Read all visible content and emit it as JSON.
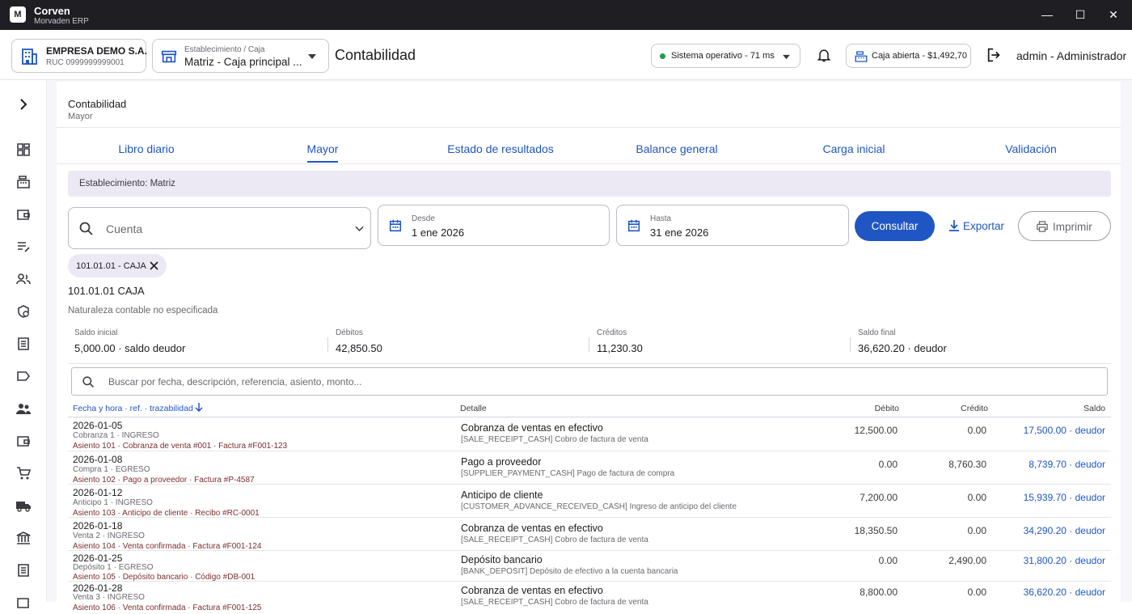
{
  "titlebar": {
    "logo": "M",
    "app": "Corven",
    "subtitle": "Morvaden ERP"
  },
  "header": {
    "company_name": "EMPRESA DEMO S.A.",
    "company_ruc": "RUC 0999999999001",
    "establishment_label": "Establecimiento / Caja",
    "establishment_value": "Matriz - Caja principal ...",
    "page_title": "Contabilidad",
    "status_text": "Sistema operativo - 71 ms",
    "cash_text": "Caja abierta - $1,492,70",
    "user_text": "admin - Administrador",
    "status_color": "#1f9d4a"
  },
  "sidebar": {
    "icons": [
      "chevron-right-icon",
      "dashboard-icon",
      "cash-register-icon",
      "wallet-icon",
      "edit-list-icon",
      "users-icon",
      "clock-badge-icon",
      "list-icon",
      "label-icon",
      "people-icon",
      "wallet-2-icon",
      "cart-icon",
      "truck-icon",
      "bank-icon",
      "document-icon",
      "more-icon"
    ]
  },
  "page": {
    "title": "Contabilidad",
    "subtitle": "Mayor"
  },
  "tabs": [
    {
      "label": "Libro diario",
      "active": false
    },
    {
      "label": "Mayor",
      "active": true
    },
    {
      "label": "Estado de resultados",
      "active": false
    },
    {
      "label": "Balance general",
      "active": false
    },
    {
      "label": "Carga inicial",
      "active": false
    },
    {
      "label": "Validación",
      "active": false
    }
  ],
  "establishment_banner": "Establecimiento: Matriz",
  "filters": {
    "account_placeholder": "Cuenta",
    "from_label": "Desde",
    "from_value": "1 ene 2026",
    "to_label": "Hasta",
    "to_value": "31 ene 2026",
    "consult_label": "Consultar",
    "export_label": "Exportar",
    "print_label": "Imprimir"
  },
  "chip": {
    "label": "101.01.01 - CAJA"
  },
  "account": {
    "title": "101.01.01 CAJA",
    "nature": "Naturaleza contable no especificada"
  },
  "summary": [
    {
      "label": "Saldo inicial",
      "value": "5,000.00 · saldo deudor"
    },
    {
      "label": "Débitos",
      "value": "42,850.50"
    },
    {
      "label": "Créditos",
      "value": "11,230.30"
    },
    {
      "label": "Saldo final",
      "value": "36,620.20 · deudor"
    }
  ],
  "search_placeholder": "Buscar por fecha, descripción, referencia, asiento, monto...",
  "table": {
    "headers": {
      "date": "Fecha y hora · ref. · trazabilidad",
      "detail": "Detalle",
      "debit": "Débito",
      "credit": "Crédito",
      "balance": "Saldo"
    },
    "rows": [
      {
        "date": "2026-01-05",
        "ref": "Cobranza 1 · INGRESO",
        "trace": "Asiento 101 · Cobranza de venta #001 · Factura #F001-123",
        "detail": "Cobranza de ventas en efectivo",
        "code": "[SALE_RECEIPT_CASH] Cobro de factura de venta",
        "debit": "12,500.00",
        "credit": "0.00",
        "balance": "17,500.00 · deudor"
      },
      {
        "date": "2026-01-08",
        "ref": "Compra 1 · EGRESO",
        "trace": "Asiento 102 · Pago a proveedor · Factura #P-4587",
        "detail": "Pago a proveedor",
        "code": "[SUPPLIER_PAYMENT_CASH] Pago de factura de compra",
        "debit": "0.00",
        "credit": "8,760.30",
        "balance": "8,739.70 · deudor"
      },
      {
        "date": "2026-01-12",
        "ref": "Anticipo 1 · INGRESO",
        "trace": "Asiento 103 · Anticipo de cliente · Recibo #RC-0001",
        "detail": "Anticipo de cliente",
        "code": "[CUSTOMER_ADVANCE_RECEIVED_CASH] Ingreso de anticipo del cliente",
        "debit": "7,200.00",
        "credit": "0.00",
        "balance": "15,939.70 · deudor"
      },
      {
        "date": "2026-01-18",
        "ref": "Venta 2 · INGRESO",
        "trace": "Asiento 104 · Venta confirmada · Factura #F001-124",
        "detail": "Cobranza de ventas en efectivo",
        "code": "[SALE_RECEIPT_CASH] Cobro de factura de venta",
        "debit": "18,350.50",
        "credit": "0.00",
        "balance": "34,290.20 · deudor"
      },
      {
        "date": "2026-01-25",
        "ref": "Depósito 1 · EGRESO",
        "trace": "Asiento 105 · Depósito bancario · Código #DB-001",
        "detail": "Depósito bancario",
        "code": "[BANK_DEPOSIT] Depósito de efectivo a la cuenta bancaria",
        "debit": "0.00",
        "credit": "2,490.00",
        "balance": "31,800.20 · deudor"
      },
      {
        "date": "2026-01-28",
        "ref": "Venta 3 · INGRESO",
        "trace": "Asiento 106 · Venta confirmada · Factura #F001-125",
        "detail": "Cobranza de ventas en efectivo",
        "code": "[SALE_RECEIPT_CASH] Cobro de factura de venta",
        "debit": "8,800.00",
        "credit": "0.00",
        "balance": "36,620.20 · deudor"
      }
    ]
  },
  "colors": {
    "accent": "#1f56c4",
    "titlebar": "#1f1e23",
    "banner": "#ece9f5"
  }
}
